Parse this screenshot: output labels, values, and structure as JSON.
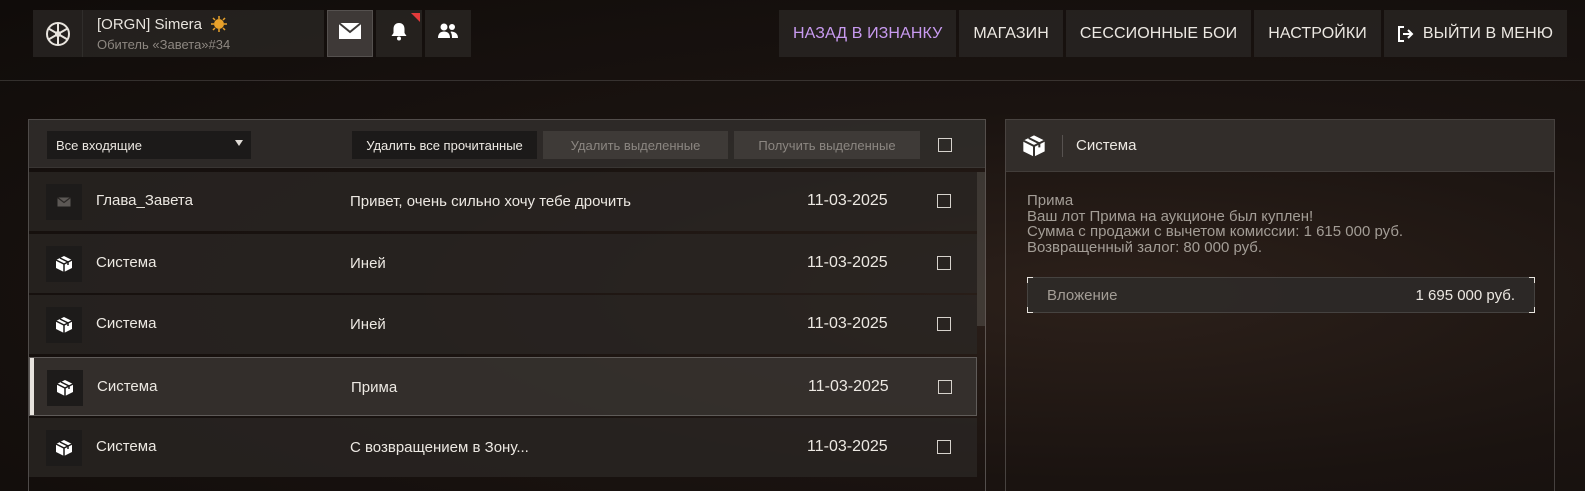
{
  "profile": {
    "name": "[ORGN] Simera",
    "subtitle": "Обитель «Завета»#34"
  },
  "topbar": {
    "icons": [
      "mail-icon",
      "bell-icon",
      "friends-icon"
    ],
    "nav": [
      {
        "label": "НАЗАД В ИЗНАНКУ",
        "color": "#c89af0"
      },
      {
        "label": "МАГАЗИН"
      },
      {
        "label": "СЕССИОННЫЕ БОИ"
      },
      {
        "label": "НАСТРОЙКИ"
      },
      {
        "label": "ВЫЙТИ В МЕНЮ"
      }
    ]
  },
  "mail": {
    "filter": "Все входящие",
    "buttons": {
      "delete_read": "Удалить все прочитанные",
      "delete_selected": "Удалить выделенные",
      "receive_selected": "Получить выделенные"
    },
    "rows": [
      {
        "icon": "envelope-icon",
        "sender": "Глава_Завета",
        "subject": "Привет, очень сильно хочу тебе дрочить",
        "date": "11-03-2025"
      },
      {
        "icon": "box-icon",
        "sender": "Система",
        "subject": "Иней",
        "date": "11-03-2025"
      },
      {
        "icon": "box-icon",
        "sender": "Система",
        "subject": "Иней",
        "date": "11-03-2025"
      },
      {
        "icon": "box-icon",
        "sender": "Система",
        "subject": "Прима",
        "date": "11-03-2025"
      },
      {
        "icon": "box-icon",
        "sender": "Система",
        "subject": "С возвращением в Зону...",
        "date": "11-03-2025"
      }
    ]
  },
  "detail": {
    "sender": "Система",
    "lines": [
      "Прима",
      "Ваш лот Прима на аукционе был куплен!",
      "Сумма с продажи с вычетом комиссии: 1 615 000 руб.",
      "Возвращенный залог: 80 000 руб."
    ],
    "attachment_label": "Вложение",
    "attachment_value": "1 695 000 руб."
  }
}
